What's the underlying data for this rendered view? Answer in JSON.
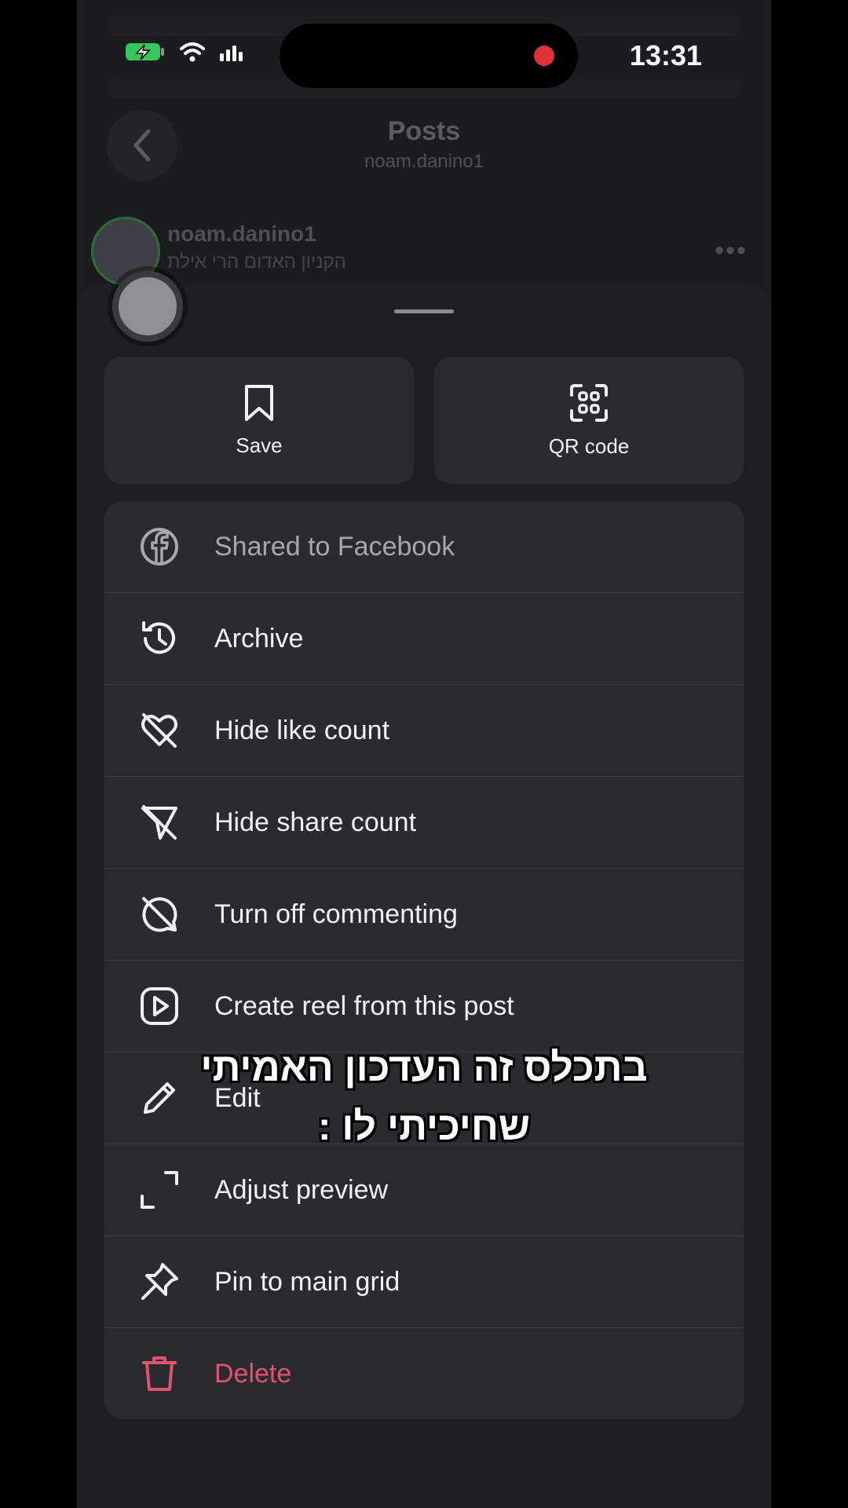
{
  "status_bar": {
    "time": "13:31"
  },
  "header": {
    "title": "Posts",
    "subtitle": "noam.danino1"
  },
  "post": {
    "username": "noam.danino1",
    "location": "הקניון האדום הרי אילת"
  },
  "sheet": {
    "top_buttons": [
      {
        "label": "Save",
        "icon": "bookmark-icon"
      },
      {
        "label": "QR code",
        "icon": "qr-code-icon"
      }
    ],
    "items": [
      {
        "label": "Shared to Facebook",
        "icon": "facebook-icon"
      },
      {
        "label": "Archive",
        "icon": "archive-icon"
      },
      {
        "label": "Hide like count",
        "icon": "hide-like-icon"
      },
      {
        "label": "Hide share count",
        "icon": "hide-share-icon"
      },
      {
        "label": "Turn off commenting",
        "icon": "comment-off-icon"
      },
      {
        "label": "Create reel from this post",
        "icon": "reel-icon"
      },
      {
        "label": "Edit",
        "icon": "pencil-icon"
      },
      {
        "label": "Adjust preview",
        "icon": "expand-icon"
      },
      {
        "label": "Pin to main grid",
        "icon": "pin-icon"
      },
      {
        "label": "Delete",
        "icon": "trash-icon"
      }
    ]
  },
  "caption": {
    "line1": "בתכלס זה העדכון האמיתי",
    "line2": "שחיכיתי לו :"
  },
  "colors": {
    "sheet_bg": "#1e1f24",
    "item_bg": "#2a2b31",
    "danger": "#e0536e",
    "muted": "#a6a8ae"
  }
}
